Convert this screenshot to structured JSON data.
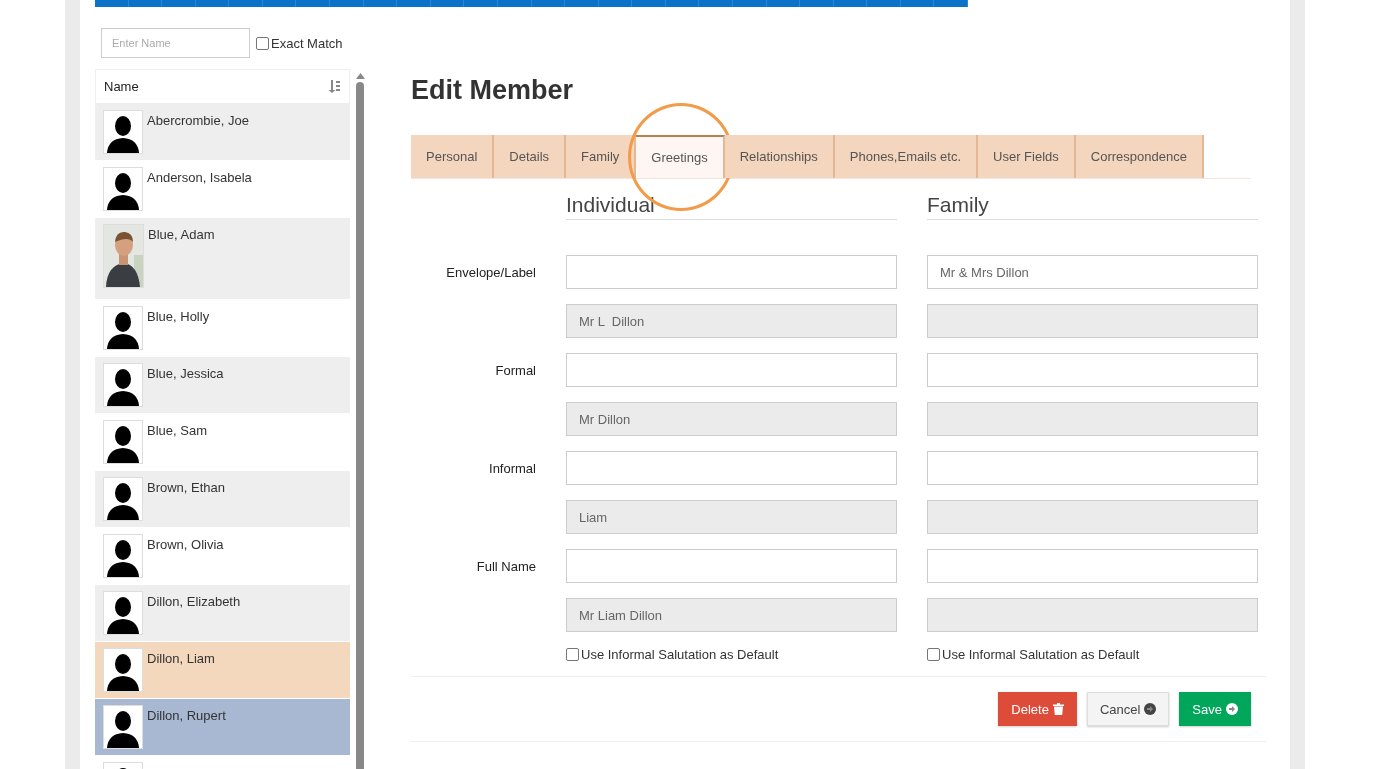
{
  "search": {
    "placeholder": "Enter Name",
    "exact_match": {
      "label": "Exact Match",
      "checked": false
    }
  },
  "list": {
    "header": "Name",
    "members": [
      {
        "name": "Abercrombie, Joe",
        "kind": "silhouette",
        "selected": false,
        "hovered": false
      },
      {
        "name": "Anderson, Isabela",
        "kind": "silhouette",
        "selected": false,
        "hovered": false
      },
      {
        "name": "Blue, Adam",
        "selected": false,
        "hovered": false
      },
      {
        "name": "Blue, Holly",
        "kind": "silhouette",
        "selected": false,
        "hovered": false
      },
      {
        "name": "Blue, Jessica",
        "kind": "silhouette",
        "selected": false,
        "hovered": false
      },
      {
        "name": "Blue, Sam",
        "kind": "silhouette",
        "selected": false,
        "hovered": false
      },
      {
        "name": "Brown, Ethan",
        "kind": "silhouette",
        "selected": false,
        "hovered": false
      },
      {
        "name": "Brown, Olivia",
        "kind": "silhouette",
        "selected": false,
        "hovered": false
      },
      {
        "name": "Dillon, Elizabeth",
        "kind": "silhouette",
        "selected": false,
        "hovered": false
      },
      {
        "name": "Dillon, Liam",
        "kind": "silhouette",
        "selected": true,
        "hovered": false
      },
      {
        "name": "Dillon, Rupert",
        "kind": "silhouette",
        "selected": false,
        "hovered": true
      },
      {
        "kind": "silhouette",
        "selected": false,
        "hovered": false
      }
    ]
  },
  "title": "Edit Member",
  "tabs": [
    {
      "label": "Personal",
      "selected": false,
      "highlighted": false
    },
    {
      "label": "Details",
      "selected": false,
      "highlighted": false
    },
    {
      "label": "Family",
      "selected": false,
      "highlighted": false
    },
    {
      "label": "Greetings",
      "selected": true,
      "highlighted": true
    },
    {
      "label": "Relationships",
      "selected": false,
      "highlighted": false
    },
    {
      "label": "Phones,Emails etc.",
      "selected": false,
      "highlighted": false
    },
    {
      "label": "User Fields",
      "selected": false,
      "highlighted": false
    },
    {
      "label": "Correspondence",
      "selected": false,
      "highlighted": false
    }
  ],
  "columns": [
    "Individual",
    "Family"
  ],
  "greetings": [
    {
      "label": "Envelope/Label",
      "individual": {
        "computed": "Mr L  Dillon"
      },
      "family": {
        "value": "Mr & Mrs Dillon"
      }
    },
    {
      "label": "Formal",
      "individual": {
        "computed": "Mr Dillon"
      }
    },
    {
      "label": "Informal",
      "individual": {
        "computed": "Liam"
      }
    },
    {
      "label": "Full Name",
      "individual": {
        "computed": "Mr Liam Dillon"
      }
    }
  ],
  "defaults": [
    {
      "label": "Use Informal Salutation as Default",
      "checked": false
    },
    {
      "label": "Use Informal Salutation as Default",
      "checked": false
    }
  ],
  "buttons": [
    {
      "label": "Delete",
      "kind": "delete"
    },
    {
      "label": "Cancel",
      "kind": "cancel"
    },
    {
      "label": "Save",
      "kind": "save"
    }
  ]
}
